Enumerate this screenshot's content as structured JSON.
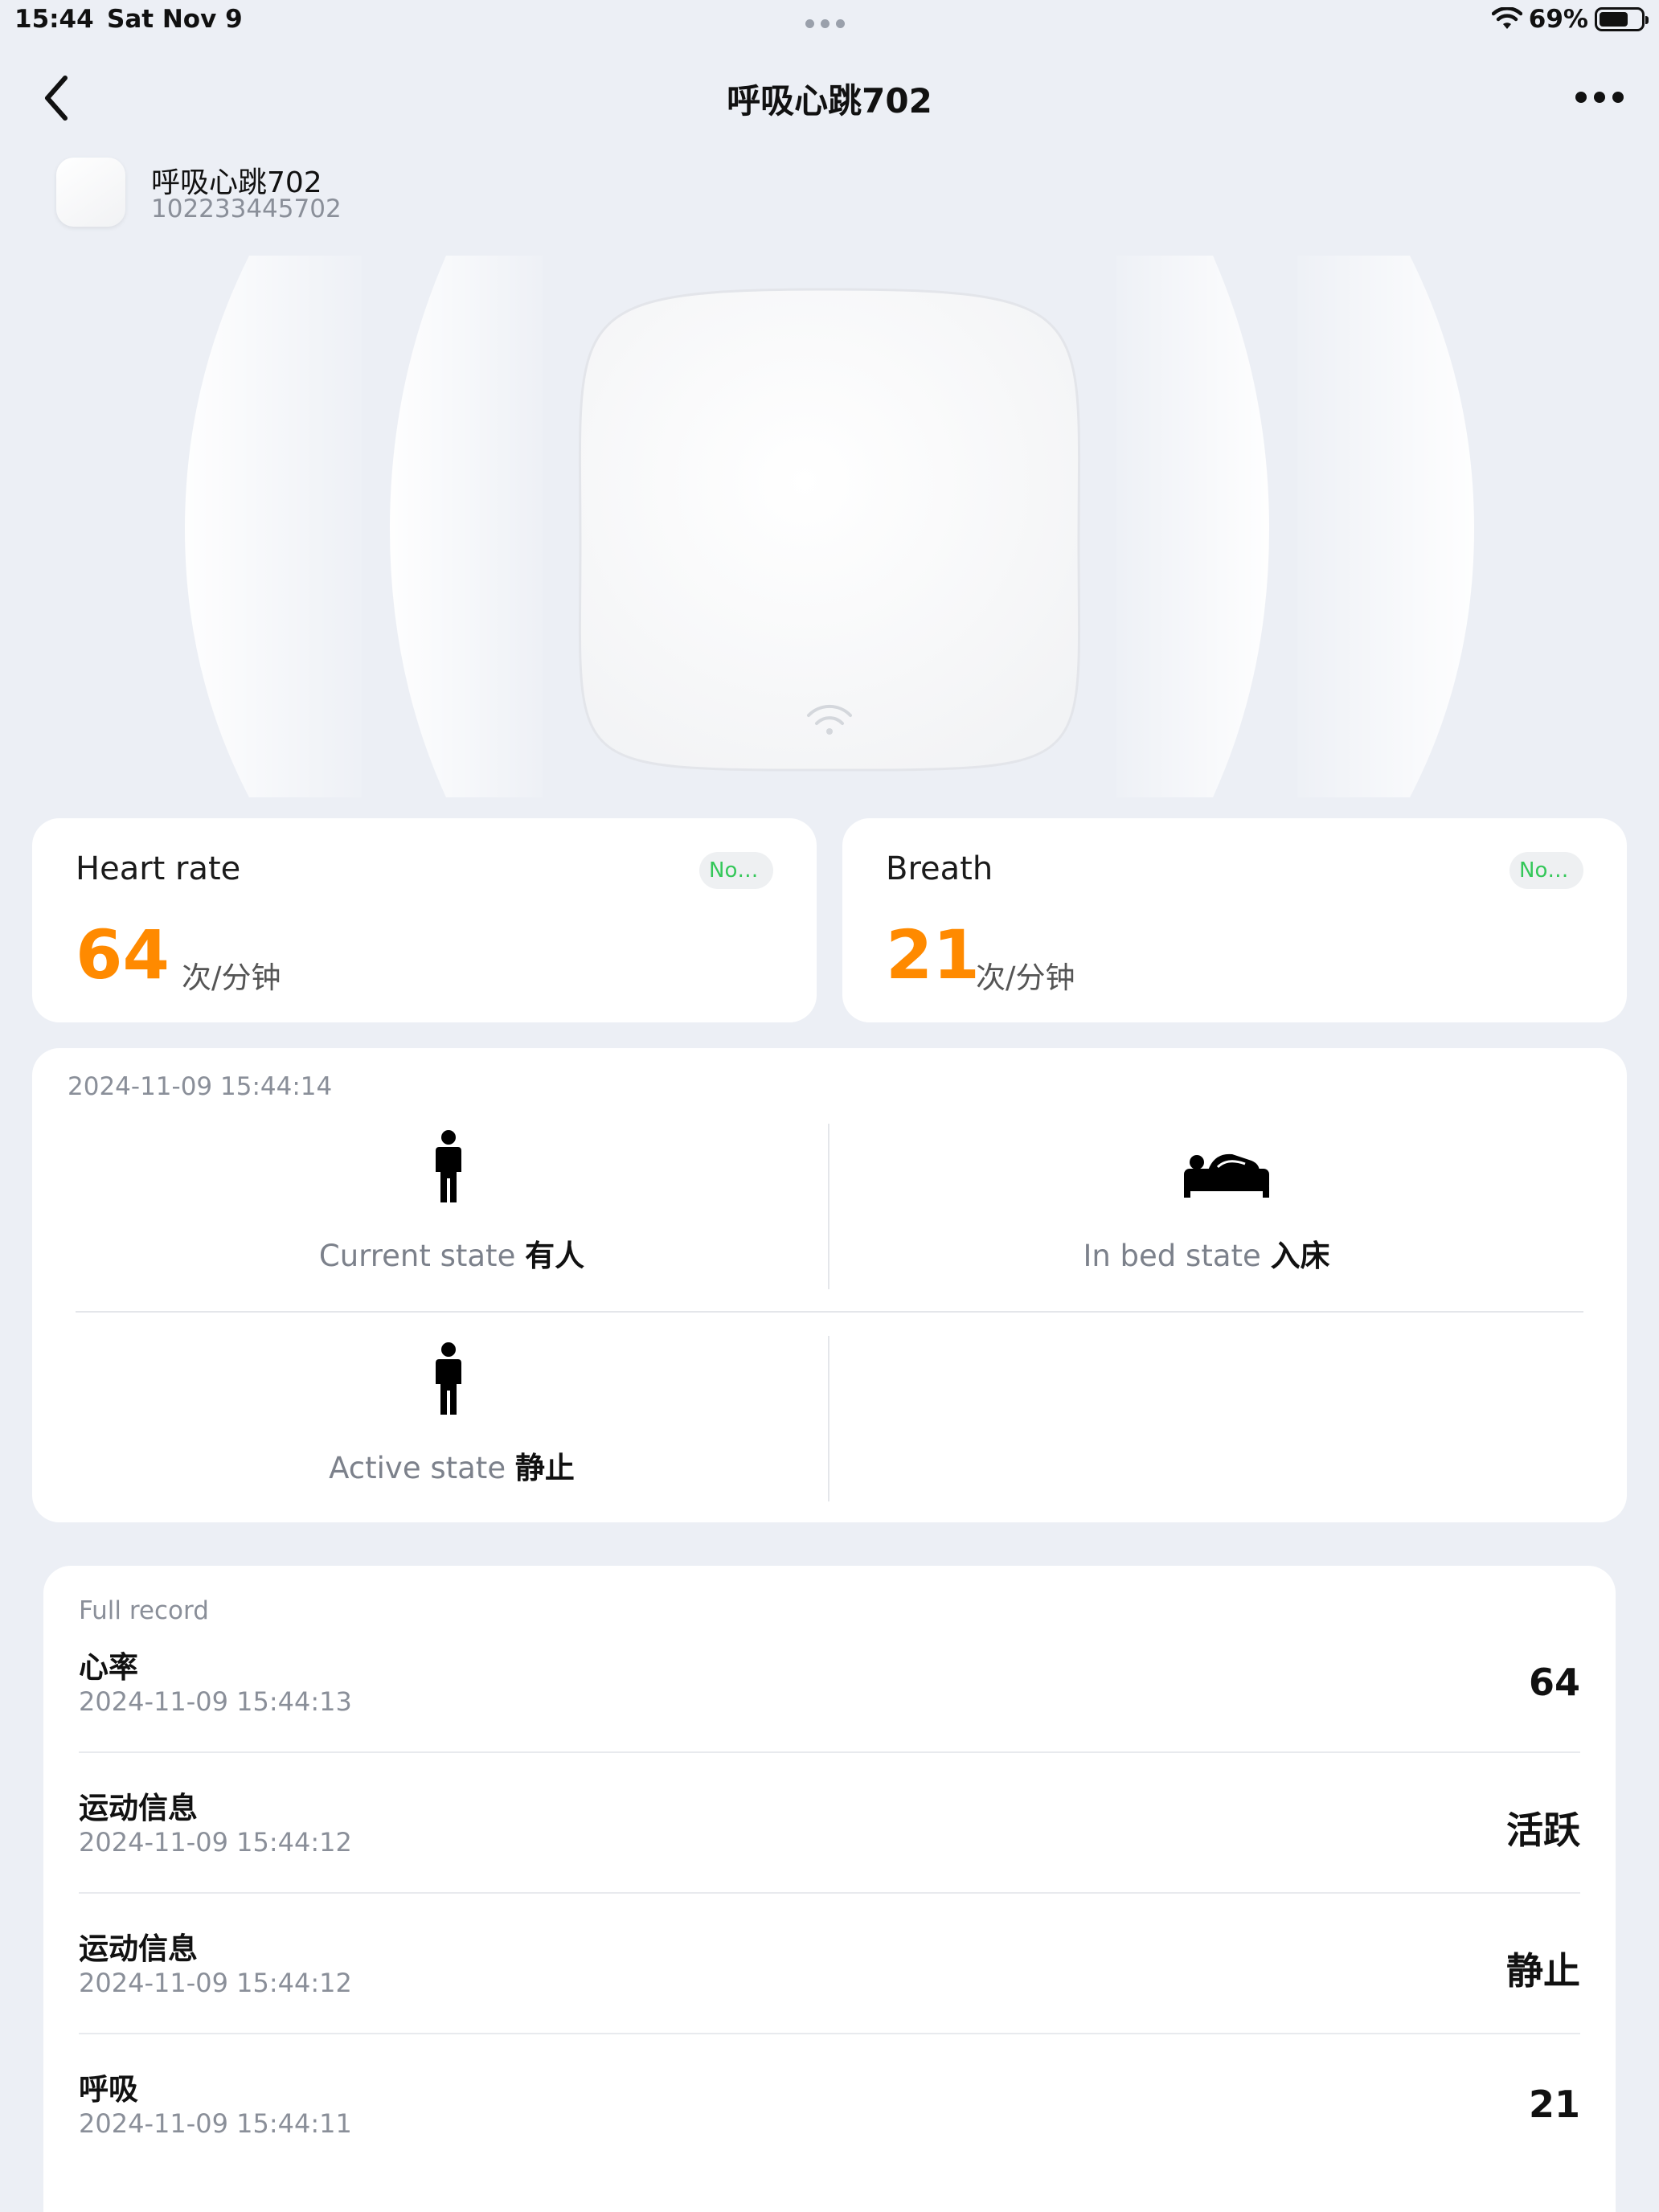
{
  "status_bar": {
    "time": "15:44",
    "date": "Sat Nov 9",
    "battery": "69%",
    "battery_level": 0.69
  },
  "nav": {
    "title": "呼吸心跳702"
  },
  "device": {
    "name": "呼吸心跳702",
    "id": "102233445702"
  },
  "metrics": [
    {
      "title": "Heart rate",
      "badge": "Nor...",
      "value": "64",
      "unit": "次/分钟"
    },
    {
      "title": "Breath",
      "badge": "Nor...",
      "value": "21",
      "unit": "次/分钟"
    }
  ],
  "status": {
    "timestamp": "2024-11-09 15:44:14",
    "current": {
      "label": "Current state",
      "value": "有人",
      "icon": "person-standing-icon"
    },
    "in_bed": {
      "label": "In bed state",
      "value": "入床",
      "icon": "person-in-bed-icon"
    },
    "active": {
      "label": "Active state",
      "value": "静止",
      "icon": "person-standing-icon"
    }
  },
  "record": {
    "title": "Full record",
    "rows": [
      {
        "name": "心率",
        "time": "2024-11-09 15:44:13",
        "value": "64"
      },
      {
        "name": "运动信息",
        "time": "2024-11-09 15:44:12",
        "value": "活跃"
      },
      {
        "name": "运动信息",
        "time": "2024-11-09 15:44:12",
        "value": "静止"
      },
      {
        "name": "呼吸",
        "time": "2024-11-09 15:44:11",
        "value": "21"
      }
    ]
  },
  "colors": {
    "accent_orange": "#ff8a00",
    "badge_green": "#34c759",
    "background": "#eceff5"
  }
}
